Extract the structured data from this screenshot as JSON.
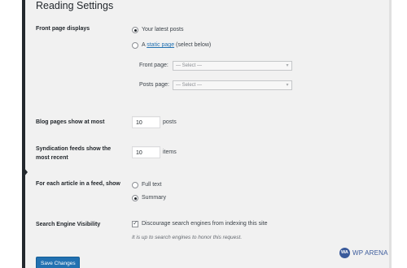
{
  "page": {
    "title": "Reading Settings"
  },
  "front_page": {
    "label": "Front page displays",
    "option_latest": "Your latest posts",
    "option_static_prefix": "A ",
    "option_static_link": "static page",
    "option_static_suffix": " (select below)",
    "selected": "latest",
    "front_page_label": "Front page:",
    "front_page_value": "— Select —",
    "posts_page_label": "Posts page:",
    "posts_page_value": "— Select —"
  },
  "blog_pages": {
    "label": "Blog pages show at most",
    "value": "10",
    "unit": "posts"
  },
  "syndication": {
    "label_line1": "Syndication feeds show the",
    "label_line2": "most recent",
    "value": "10",
    "unit": "items"
  },
  "feed_article": {
    "label": "For each article in a feed, show",
    "option_full": "Full text",
    "option_summary": "Summary",
    "selected": "summary"
  },
  "search_engine": {
    "label": "Search Engine Visibility",
    "checkbox_label": "Discourage search engines from indexing this site",
    "checked": true,
    "description": "It is up to search engines to honor this request."
  },
  "save_button": {
    "label": "Save Changes"
  },
  "watermark": {
    "logo_text": "WA",
    "text": "WP ARENA"
  },
  "colors": {
    "accent": "#2271b1",
    "admin_bar": "#23282d",
    "background": "#f1f1f1"
  }
}
